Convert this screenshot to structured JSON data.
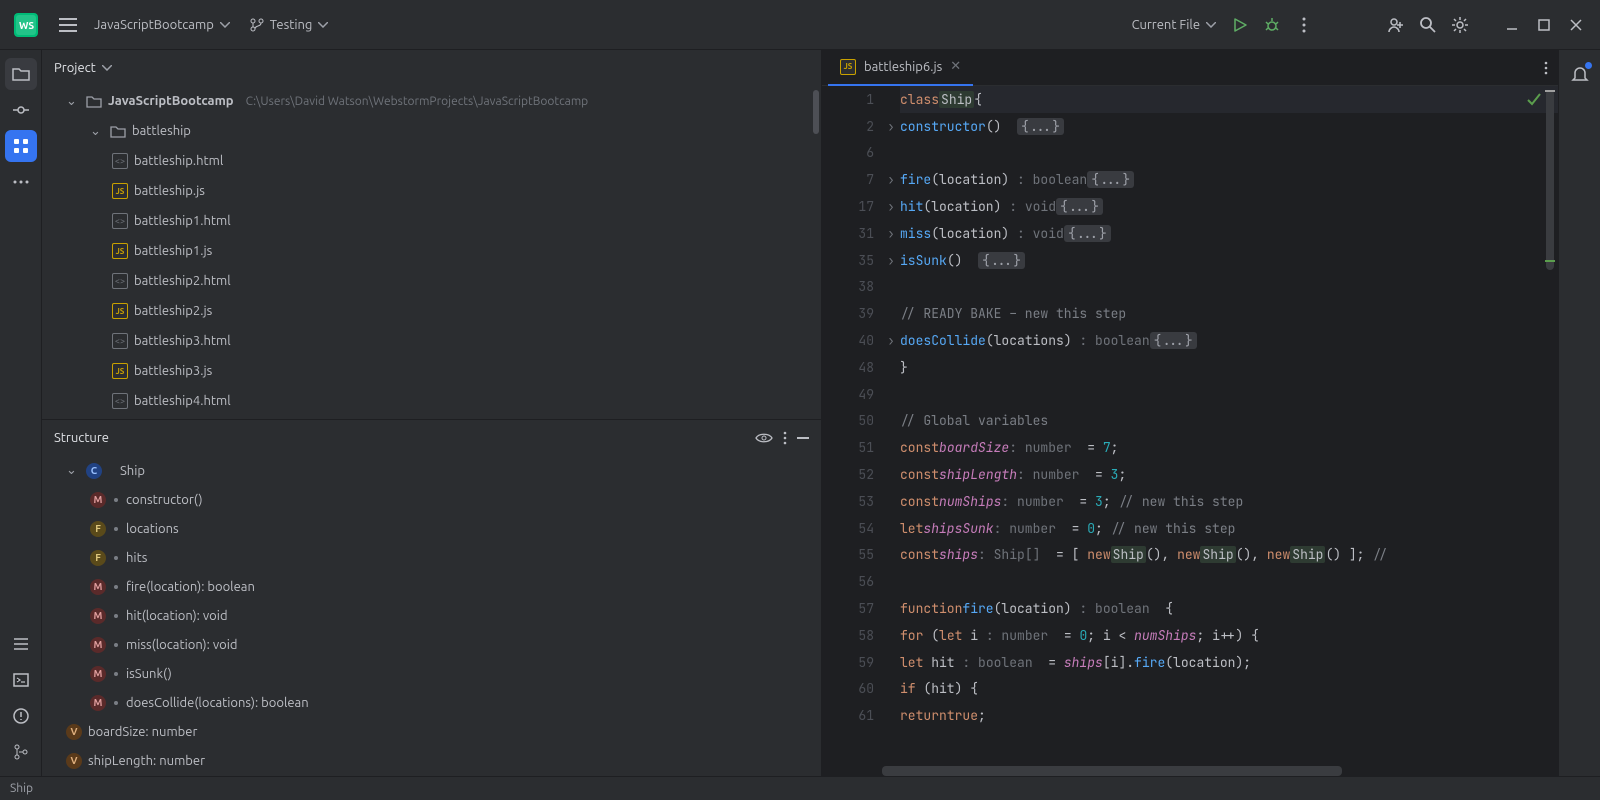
{
  "titlebar": {
    "project": "JavaScriptBootcamp",
    "branch": "Testing",
    "run_config": "Current File"
  },
  "project_panel": {
    "title": "Project",
    "root": "JavaScriptBootcamp",
    "root_path": "C:\\Users\\David Watson\\WebstormProjects\\JavaScriptBootcamp",
    "folder": "battleship",
    "files": [
      {
        "name": "battleship.html",
        "type": "html"
      },
      {
        "name": "battleship.js",
        "type": "js"
      },
      {
        "name": "battleship1.html",
        "type": "html"
      },
      {
        "name": "battleship1.js",
        "type": "js"
      },
      {
        "name": "battleship2.html",
        "type": "html"
      },
      {
        "name": "battleship2.js",
        "type": "js"
      },
      {
        "name": "battleship3.html",
        "type": "html"
      },
      {
        "name": "battleship3.js",
        "type": "js"
      },
      {
        "name": "battleship4.html",
        "type": "html"
      }
    ]
  },
  "structure_panel": {
    "title": "Structure",
    "class": "Ship",
    "members": [
      {
        "kind": "m",
        "label": "constructor()"
      },
      {
        "kind": "f",
        "label": "locations"
      },
      {
        "kind": "f",
        "label": "hits"
      },
      {
        "kind": "m",
        "label": "fire(location): boolean"
      },
      {
        "kind": "m",
        "label": "hit(location): void"
      },
      {
        "kind": "m",
        "label": "miss(location): void"
      },
      {
        "kind": "m",
        "label": "isSunk()"
      },
      {
        "kind": "m",
        "label": "doesCollide(locations): boolean"
      }
    ],
    "globals": [
      {
        "kind": "v",
        "label": "boardSize: number"
      },
      {
        "kind": "v",
        "label": "shipLength: number"
      }
    ]
  },
  "editor": {
    "tab_name": "battleship6.js",
    "breadcrumb": "Ship",
    "lines": [
      {
        "n": 1,
        "html": "<span class='kw'>class</span> <span class='type-name'>Ship</span> <span class='cls'>{</span>"
      },
      {
        "n": 2,
        "fold": ">",
        "html": "    <span class='fn'>constructor</span>()  <span class='fold-badge'>{...}</span>"
      },
      {
        "n": 6,
        "html": ""
      },
      {
        "n": 7,
        "fold": ">",
        "html": "    <span class='fn'>fire</span>(location) <span class='hint'>: boolean</span>  <span class='fold-badge'>{...}</span>"
      },
      {
        "n": 17,
        "fold": ">",
        "html": "    <span class='fn'>hit</span>(location) <span class='hint'>: void</span>  <span class='fold-badge'>{...}</span>"
      },
      {
        "n": 31,
        "fold": ">",
        "html": "    <span class='fn'>miss</span>(location) <span class='hint'>: void</span>  <span class='fold-badge'>{...}</span>"
      },
      {
        "n": 35,
        "fold": ">",
        "html": "    <span class='fn'>isSunk</span>()  <span class='fold-badge'>{...}</span>"
      },
      {
        "n": 38,
        "html": ""
      },
      {
        "n": 39,
        "html": "    <span class='com'>// READY BAKE – new this step</span>"
      },
      {
        "n": 40,
        "fold": ">",
        "html": "    <span class='fn'>doesCollide</span>(locations) <span class='hint'>: boolean</span>  <span class='fold-badge'>{...}</span>"
      },
      {
        "n": 48,
        "html": "<span class='cls'>}</span>"
      },
      {
        "n": 49,
        "html": ""
      },
      {
        "n": 50,
        "html": "<span class='com'>// Global variables</span>"
      },
      {
        "n": 51,
        "html": "<span class='kw'>const</span> <span class='id'>boardSize</span> <span class='hint'>: number</span>  = <span class='num'>7</span>;"
      },
      {
        "n": 52,
        "html": "<span class='kw'>const</span> <span class='id'>shipLength</span> <span class='hint'>: number</span>  = <span class='num'>3</span>;"
      },
      {
        "n": 53,
        "html": "<span class='kw'>const</span> <span class='id'>numShips</span> <span class='hint'>: number</span>  = <span class='num'>3</span>; <span class='com'>// new this step</span>"
      },
      {
        "n": 54,
        "html": "<span class='kw'>let</span> <span class='id'>shipsSunk</span> <span class='hint'>: number</span>  = <span class='num'>0</span>; <span class='com'>// new this step</span>"
      },
      {
        "n": 55,
        "html": "<span class='kw'>const</span> <span class='id'>ships</span> <span class='hint'>: Ship[]</span>  = [ <span class='kw'>new</span> <span class='type-name'>Ship</span>(), <span class='kw'>new</span> <span class='type-name'>Ship</span>(), <span class='kw'>new</span> <span class='type-name'>Ship</span>() ]; <span class='com'>//</span>"
      },
      {
        "n": 56,
        "html": ""
      },
      {
        "n": 57,
        "html": "<span class='kw'>function</span> <span class='fn'>fire</span>(location) <span class='hint'>: boolean</span>  {"
      },
      {
        "n": 58,
        "html": "    <span class='kw'>for</span> (<span class='kw'>let</span> i <span class='hint'>: number</span>  = <span class='num'>0</span>; i &lt; <span class='id'>numShips</span>; i++) {"
      },
      {
        "n": 59,
        "html": "        <span class='kw'>let</span> hit <span class='hint'>: boolean</span>  = <span class='id'>ships</span>[i].<span class='fn'>fire</span>(location);"
      },
      {
        "n": 60,
        "html": "        <span class='kw'>if</span> (hit) {"
      },
      {
        "n": 61,
        "html": "            <span class='kw'>return</span> <span class='kw'>true</span>;"
      }
    ]
  },
  "colors": {
    "accent": "#3574f0"
  }
}
